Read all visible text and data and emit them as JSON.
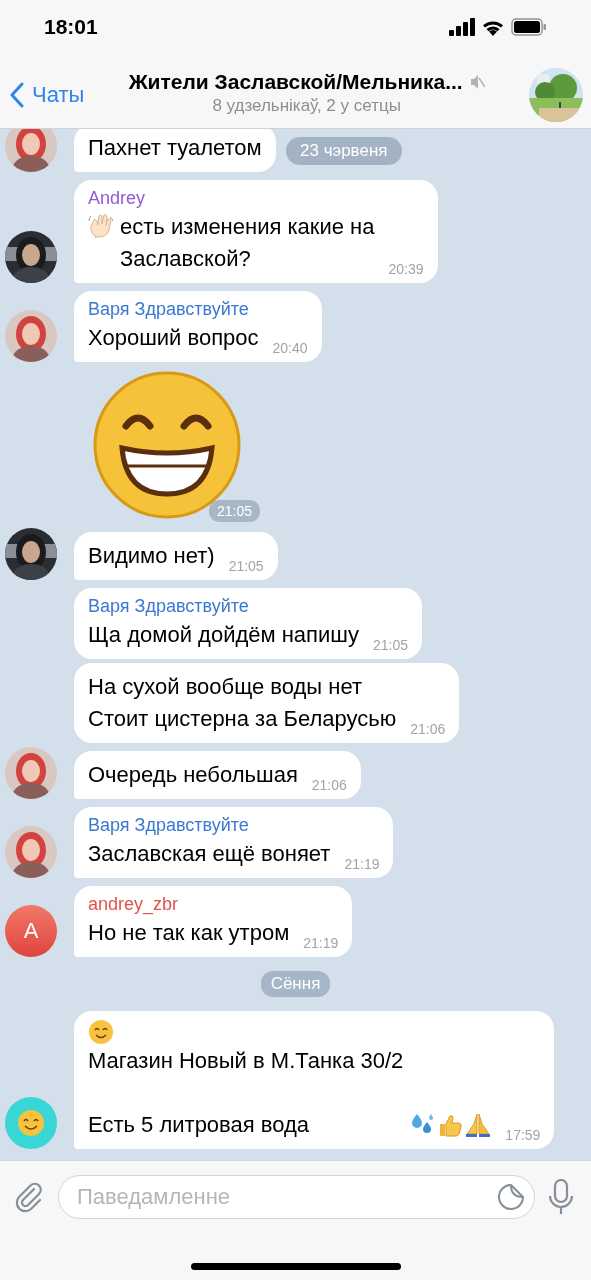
{
  "status_bar": {
    "time": "18:01"
  },
  "header": {
    "back_label": "Чаты",
    "title": "Жители Заславской/Мельника...",
    "subtitle": "8 удзельнікаў, 2 у сетцы",
    "muted": true
  },
  "floating_date": "23 чэрвеня",
  "messages": [
    {
      "kind": "text",
      "text": "Пахнет туалетом",
      "tail": true
    },
    {
      "kind": "greeting",
      "sender": "Andrey",
      "color": "#8e5bd6",
      "text": "есть изменения какие на\nЗаславской?",
      "time": "20:39",
      "avatar": {
        "kind": "photo-dark"
      },
      "tail": true
    },
    {
      "kind": "text",
      "sender": "Варя Здравствуйте",
      "color": "#3a78d2",
      "text": "Хороший вопрос",
      "time": "20:40",
      "tail": true
    },
    {
      "kind": "sticker",
      "time": "21:05"
    },
    {
      "kind": "text",
      "text": "Видимо нет)",
      "time": "21:05",
      "avatar": {
        "kind": "photo-dark"
      },
      "tail": true
    },
    {
      "kind": "text",
      "sender": "Варя Здравствуйте",
      "color": "#3a78d2",
      "text": "Ща домой дойдём напишу",
      "time": "21:05",
      "tail": false
    },
    {
      "kind": "text",
      "text": "На сухой вообще воды нет\nСтоит цистерна за Беларусью",
      "time": "21:06",
      "tail": false
    },
    {
      "kind": "text",
      "text": "Очередь небольшая",
      "time": "21:06",
      "tail": true
    },
    {
      "kind": "text",
      "sender": "Варя Здравствуйте",
      "color": "#3a78d2",
      "text": "Заславская ещё воняет",
      "time": "21:19",
      "tail": true
    },
    {
      "kind": "text",
      "sender": "andrey_zbr",
      "color": "#e0524a",
      "text": "Но не так как утром",
      "time": "21:19",
      "avatar": {
        "kind": "letter",
        "letter": "A"
      },
      "tail": true
    },
    {
      "kind": "date",
      "text": "Сёння"
    },
    {
      "kind": "announcement",
      "text": "Магазин Новый в М.Танка 30/2\n\nЕсть 5 литровая вода",
      "time": "17:59",
      "avatar": {
        "kind": "emoji"
      },
      "tail": true
    }
  ],
  "composer": {
    "placeholder": "Паведамленне"
  }
}
